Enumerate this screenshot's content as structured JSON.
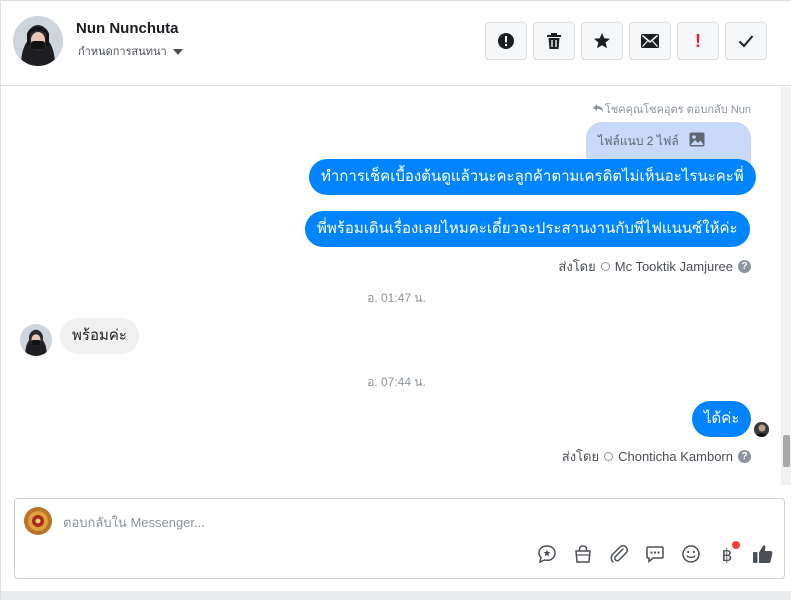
{
  "header": {
    "name": "Nun Nunchuta",
    "subtitle": "กำหนดการสนทนา",
    "actions": [
      {
        "icon": "alert-circle-icon"
      },
      {
        "icon": "trash-icon"
      },
      {
        "icon": "star-icon"
      },
      {
        "icon": "envelope-icon"
      },
      {
        "icon": "exclamation-icon",
        "glyph": "!"
      },
      {
        "icon": "checkmark-icon"
      }
    ]
  },
  "messages": {
    "reply_note": "โชคคุณโชคอุตร ตอบกลับ Nun",
    "attachment_label": "ไฟล์แนบ 2 ไฟล์",
    "out_msg_1": "ทำการเช็คเบื้องต้นดูแล้วนะคะลูกค้าตามเครดิตไม่เห็นอะไรนะคะพี่",
    "out_msg_2": "พี่พร้อมเดินเรื่องเลยไหมคะเดี๋ยวจะประสานงานกับพี่ไฟแนนซ์ให้ค่ะ",
    "sent_by_label": "ส่งโดย",
    "sent_by_agent_1": "Mc Tooktik Jamjuree",
    "time_1": "อ. 01:47 น.",
    "in_msg_1": "พร้อมค่ะ",
    "time_2": "อ. 07:44 น.",
    "out_msg_3": "ได้ค่ะ",
    "sent_by_agent_2": "Chonticha Kamborn",
    "help_glyph": "?"
  },
  "composer": {
    "placeholder": "ตอบกลับใน Messenger...",
    "icons": [
      "saved-reply-icon",
      "shopping-bag-icon",
      "paperclip-icon",
      "chat-bubble-icon",
      "emoji-icon",
      "baht-payment-icon",
      "thumbs-up-icon"
    ],
    "baht_glyph": "฿"
  },
  "colors": {
    "accent": "#0084ff",
    "incoming_bubble": "#f1f0f0",
    "attachment_bubble": "#c8daf8",
    "notification_dot": "#fa3e3e"
  }
}
